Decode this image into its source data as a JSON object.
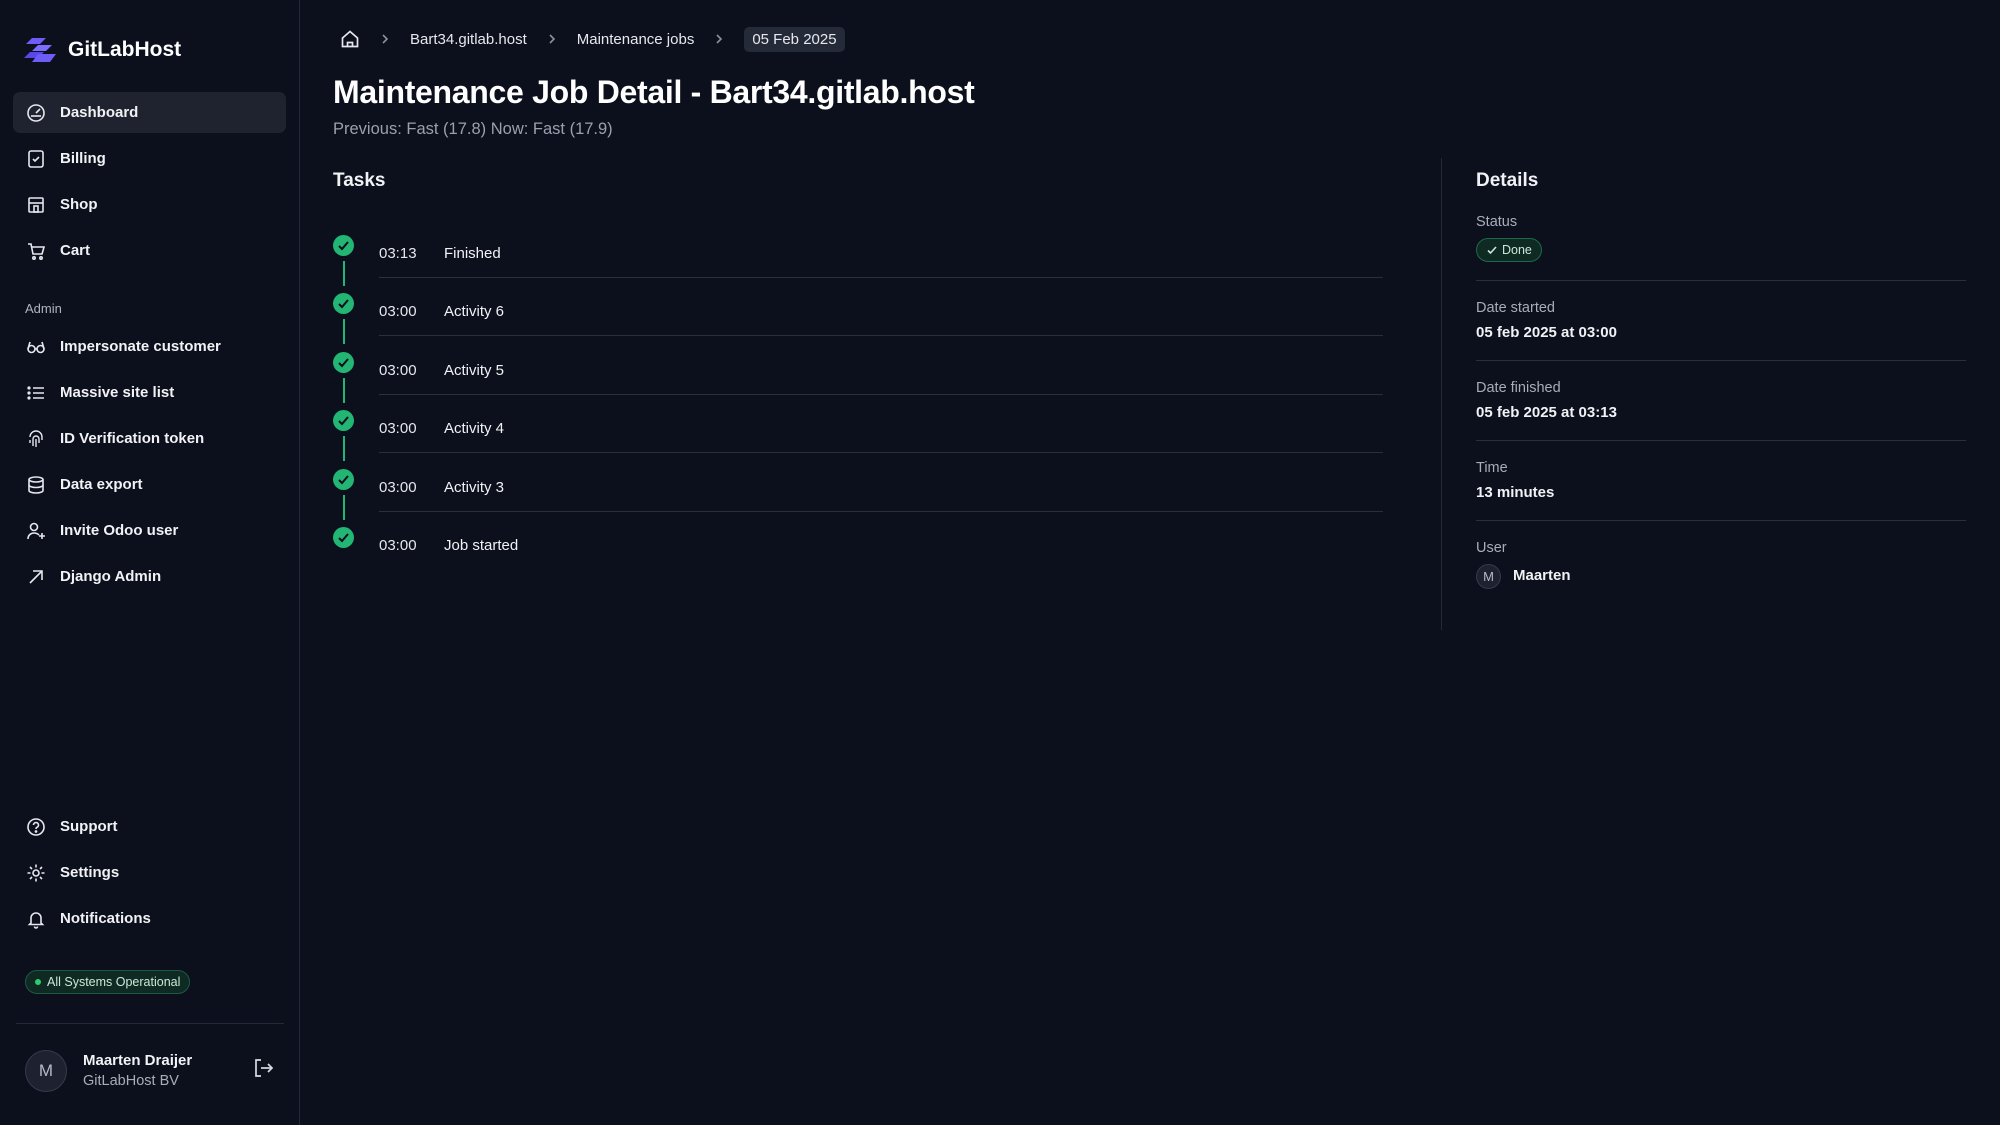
{
  "brand": {
    "name": "GitLabHost",
    "accent": "#6d5cf6"
  },
  "sidebar": {
    "items": [
      {
        "label": "Dashboard",
        "icon": "dashboard-icon",
        "active": true
      },
      {
        "label": "Billing",
        "icon": "billing-icon"
      },
      {
        "label": "Shop",
        "icon": "shop-icon"
      },
      {
        "label": "Cart",
        "icon": "cart-icon"
      }
    ],
    "admin_label": "Admin",
    "admin_items": [
      {
        "label": "Impersonate customer",
        "icon": "glasses-icon"
      },
      {
        "label": "Massive site list",
        "icon": "list-icon"
      },
      {
        "label": "ID Verification token",
        "icon": "fingerprint-icon"
      },
      {
        "label": "Data export",
        "icon": "database-icon"
      },
      {
        "label": "Invite Odoo user",
        "icon": "user-plus-icon"
      },
      {
        "label": "Django Admin",
        "icon": "arrow-up-right-icon"
      }
    ],
    "bottom_items": [
      {
        "label": "Support",
        "icon": "help-icon"
      },
      {
        "label": "Settings",
        "icon": "gear-icon"
      },
      {
        "label": "Notifications",
        "icon": "bell-icon"
      }
    ],
    "system_status": "All Systems Operational",
    "user": {
      "initial": "M",
      "name": "Maarten Draijer",
      "org": "GitLabHost BV"
    }
  },
  "breadcrumb": {
    "items": [
      "Bart34.gitlab.host",
      "Maintenance jobs"
    ],
    "current": "05 Feb 2025"
  },
  "page": {
    "title": "Maintenance Job Detail - Bart34.gitlab.host",
    "subtitle": "Previous: Fast (17.8) Now: Fast (17.9)"
  },
  "tasks": {
    "title": "Tasks",
    "items": [
      {
        "time": "03:13",
        "label": "Finished"
      },
      {
        "time": "03:00",
        "label": "Activity 6"
      },
      {
        "time": "03:00",
        "label": "Activity 5"
      },
      {
        "time": "03:00",
        "label": "Activity 4"
      },
      {
        "time": "03:00",
        "label": "Activity 3"
      },
      {
        "time": "03:00",
        "label": "Job started"
      }
    ],
    "success_color": "#22b573"
  },
  "details": {
    "title": "Details",
    "status_label": "Status",
    "status_value": "Done",
    "date_started_label": "Date started",
    "date_started_value": "05 feb 2025 at 03:00",
    "date_finished_label": "Date finished",
    "date_finished_value": "05 feb 2025 at 03:13",
    "time_label": "Time",
    "time_value": "13 minutes",
    "user_label": "User",
    "user_initial": "M",
    "user_name": "Maarten"
  }
}
